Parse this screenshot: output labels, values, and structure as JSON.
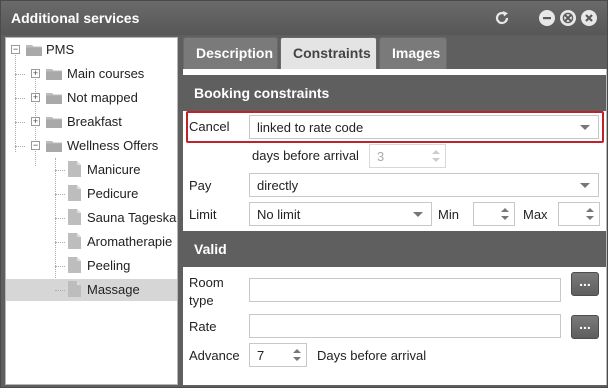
{
  "window": {
    "title": "Additional services",
    "controls": {
      "refresh_icon": "refresh-icon",
      "minimize_icon": "minimize-icon",
      "restore_icon": "restore-icon",
      "close_icon": "close-icon"
    }
  },
  "tree": {
    "root": "PMS",
    "items": [
      {
        "label": "Main courses",
        "type": "folder",
        "expander": "+"
      },
      {
        "label": "Not mapped",
        "type": "folder",
        "expander": "+"
      },
      {
        "label": "Breakfast",
        "type": "folder",
        "expander": "+"
      },
      {
        "label": "Wellness Offers",
        "type": "folder",
        "expander": "−"
      }
    ],
    "children": [
      {
        "label": "Manicure"
      },
      {
        "label": "Pedicure"
      },
      {
        "label": "Sauna Tageskarte"
      },
      {
        "label": "Aromatherapie"
      },
      {
        "label": "Peeling"
      },
      {
        "label": "Massage",
        "selected": true
      }
    ]
  },
  "tabs": [
    {
      "label": "Description",
      "active": false
    },
    {
      "label": "Constraints",
      "active": true
    },
    {
      "label": "Images",
      "active": false
    }
  ],
  "booking": {
    "header": "Booking constraints",
    "cancel_label": "Cancel",
    "cancel_value": "linked to rate code",
    "days_before_label": "days before arrival",
    "days_before_value": "3",
    "pay_label": "Pay",
    "pay_value": "directly",
    "limit_label": "Limit",
    "limit_value": "No limit",
    "min_label": "Min",
    "min_value": "",
    "max_label": "Max",
    "max_value": ""
  },
  "valid": {
    "header": "Valid",
    "room_type_label_1": "Room",
    "room_type_label_2": "type",
    "room_type_value": "",
    "rate_label": "Rate",
    "rate_value": "",
    "browse_label": "...",
    "advance_label": "Advance",
    "advance_value": "7",
    "advance_suffix": "Days before arrival"
  },
  "colors": {
    "titlebar": "#5f5f5f",
    "highlight": "#c0222c",
    "selected_row": "#d6d6d6"
  }
}
